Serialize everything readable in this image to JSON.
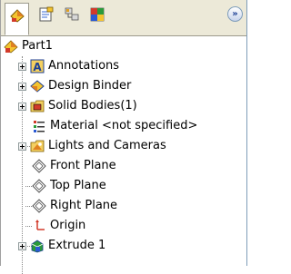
{
  "panel": {
    "tabs": [
      {
        "name": "feature-manager",
        "active": true
      },
      {
        "name": "property-manager",
        "active": false
      },
      {
        "name": "configuration-manager",
        "active": false
      },
      {
        "name": "display-manager",
        "active": false
      }
    ],
    "expand_glyph": "»"
  },
  "tree": {
    "root": {
      "label": "Part1",
      "icon": "part-icon"
    },
    "items": [
      {
        "label": "Annotations",
        "icon": "annotations-icon",
        "expandable": true
      },
      {
        "label": "Design Binder",
        "icon": "design-binder-icon",
        "expandable": true
      },
      {
        "label": "Solid Bodies(1)",
        "icon": "solid-bodies-icon",
        "expandable": true
      },
      {
        "label": "Material <not specified>",
        "icon": "material-icon",
        "expandable": false
      },
      {
        "label": "Lights and Cameras",
        "icon": "lights-cameras-icon",
        "expandable": true
      },
      {
        "label": "Front Plane",
        "icon": "plane-icon",
        "expandable": false
      },
      {
        "label": "Top Plane",
        "icon": "plane-icon",
        "expandable": false
      },
      {
        "label": "Right Plane",
        "icon": "plane-icon",
        "expandable": false
      },
      {
        "label": "Origin",
        "icon": "origin-icon",
        "expandable": false
      },
      {
        "label": "Extrude 1",
        "icon": "extrude-icon",
        "expandable": true
      }
    ]
  },
  "colors": {
    "tab_background": "#ece9d8",
    "panel_background": "#ffffff",
    "accent_blue": "#1c3f94"
  }
}
